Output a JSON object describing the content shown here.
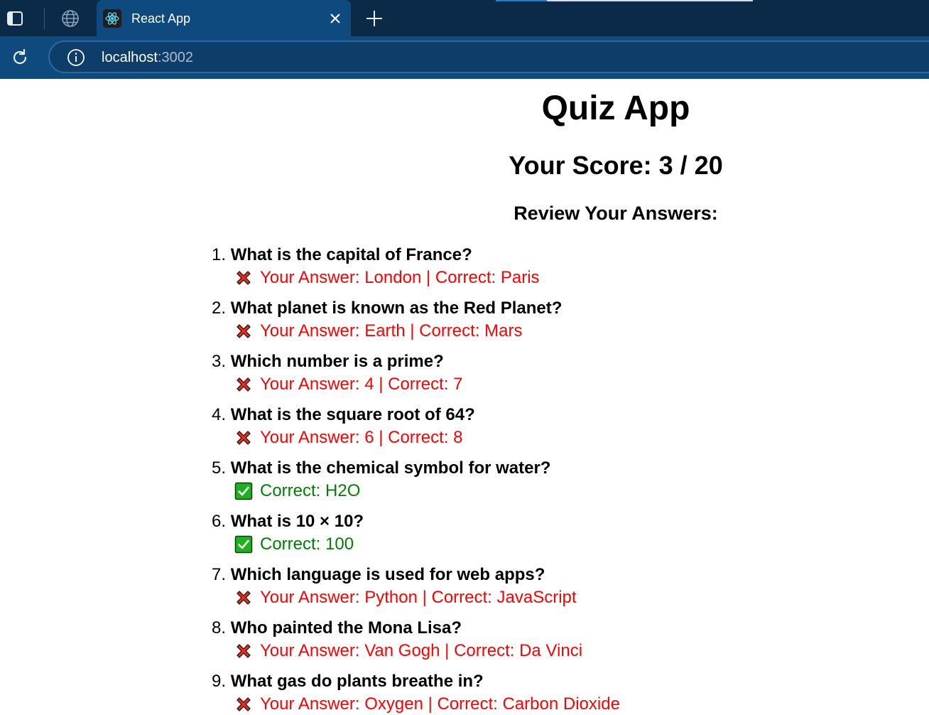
{
  "browser": {
    "tab_title": "React App",
    "url_host": "localhost",
    "url_port": ":3002",
    "load_progress": 0.2
  },
  "app": {
    "title": "Quiz App",
    "score_text": "Your Score: 3 / 20",
    "review_heading": "Review Your Answers:"
  },
  "questions": [
    {
      "num": "1.",
      "question": "What is the capital of France?",
      "correct": false,
      "result": "Your Answer: London | Correct: Paris"
    },
    {
      "num": "2.",
      "question": "What planet is known as the Red Planet?",
      "correct": false,
      "result": "Your Answer: Earth | Correct: Mars"
    },
    {
      "num": "3.",
      "question": "Which number is a prime?",
      "correct": false,
      "result": "Your Answer: 4 | Correct: 7"
    },
    {
      "num": "4.",
      "question": "What is the square root of 64?",
      "correct": false,
      "result": "Your Answer: 6 | Correct: 8"
    },
    {
      "num": "5.",
      "question": "What is the chemical symbol for water?",
      "correct": true,
      "result": "Correct: H2O"
    },
    {
      "num": "6.",
      "question": "What is 10 × 10?",
      "correct": true,
      "result": "Correct: 100"
    },
    {
      "num": "7.",
      "question": "Which language is used for web apps?",
      "correct": false,
      "result": "Your Answer: Python | Correct: JavaScript"
    },
    {
      "num": "8.",
      "question": "Who painted the Mona Lisa?",
      "correct": false,
      "result": "Your Answer: Van Gogh | Correct: Da Vinci"
    },
    {
      "num": "9.",
      "question": "What gas do plants breathe in?",
      "correct": false,
      "result": "Your Answer: Oxygen | Correct: Carbon Dioxide"
    }
  ],
  "icons": {
    "wrong": "cross-mark-icon",
    "right": "check-mark-icon"
  },
  "colors": {
    "wrong_text": "#ff0000",
    "right_text": "#008000",
    "wrong_icon": "#e0301e",
    "right_icon": "#1db31d",
    "chrome_dark": "#0b2a48",
    "chrome_active": "#0f4a7f"
  }
}
